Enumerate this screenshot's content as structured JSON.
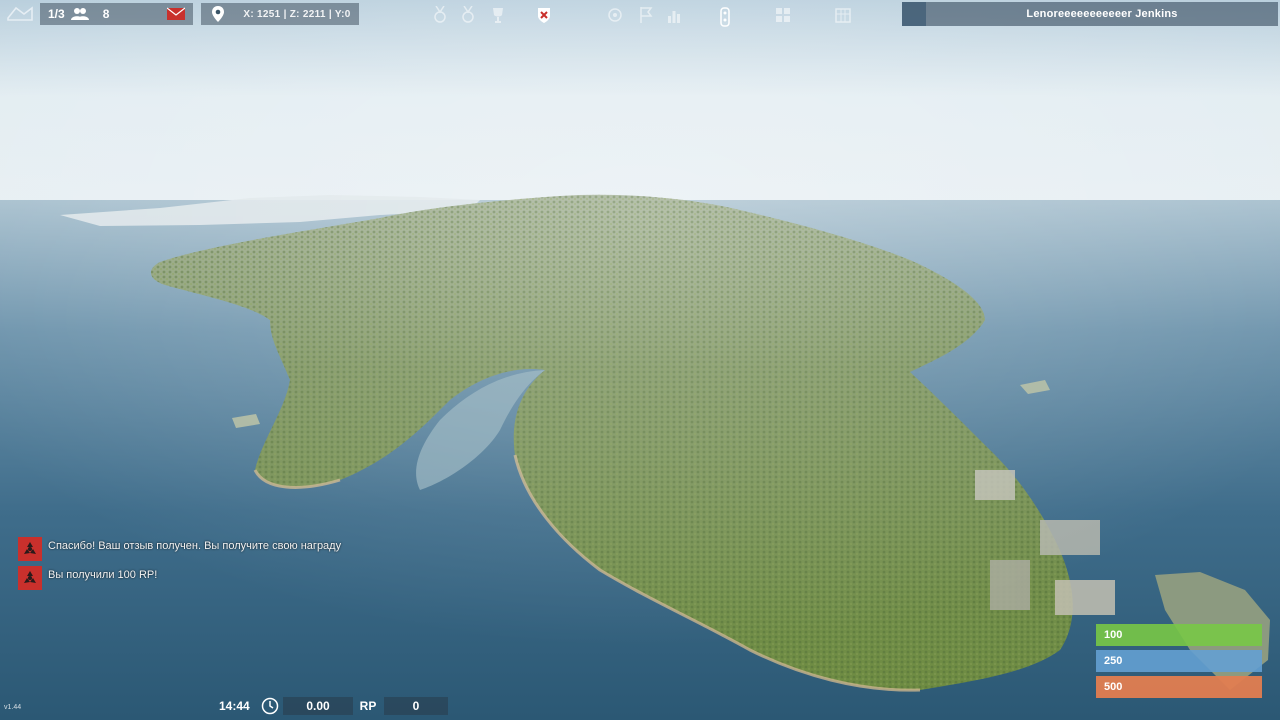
{
  "topbar": {
    "squad_count": "1/3",
    "friends_count": "8",
    "coordinates": "X: 1251 | Z: 2211 | Y:0",
    "player_name": "Lenoreeeeeeeeeeer Jenkins",
    "center_icons": [
      "medal-icon",
      "medal-icon",
      "trophy-icon",
      "shield-badge-icon",
      "target-icon",
      "flag-icon",
      "ranking-icon",
      "marker-icon",
      "grid-icon",
      "crate-icon"
    ]
  },
  "notifications": [
    {
      "icon": "hazard-icon",
      "text": "Спасибо! Ваш отзыв получен. Вы получите свою награду"
    },
    {
      "icon": "hazard-icon",
      "text": "Вы получили 100 RP!"
    }
  ],
  "bottombar": {
    "version": "v1.44",
    "time": "14:44",
    "rp_value": "0.00",
    "rp_label": "RP",
    "count": "0"
  },
  "xp_bars": [
    {
      "value": "100",
      "color": "#78c846"
    },
    {
      "value": "250",
      "color": "#64a0d2"
    },
    {
      "value": "500",
      "color": "#e17d50"
    }
  ],
  "colors": {
    "alert_red": "#c9302c",
    "sea": "#3b6b8a",
    "sky": "#dde9ef",
    "land": "#6d8a46"
  }
}
